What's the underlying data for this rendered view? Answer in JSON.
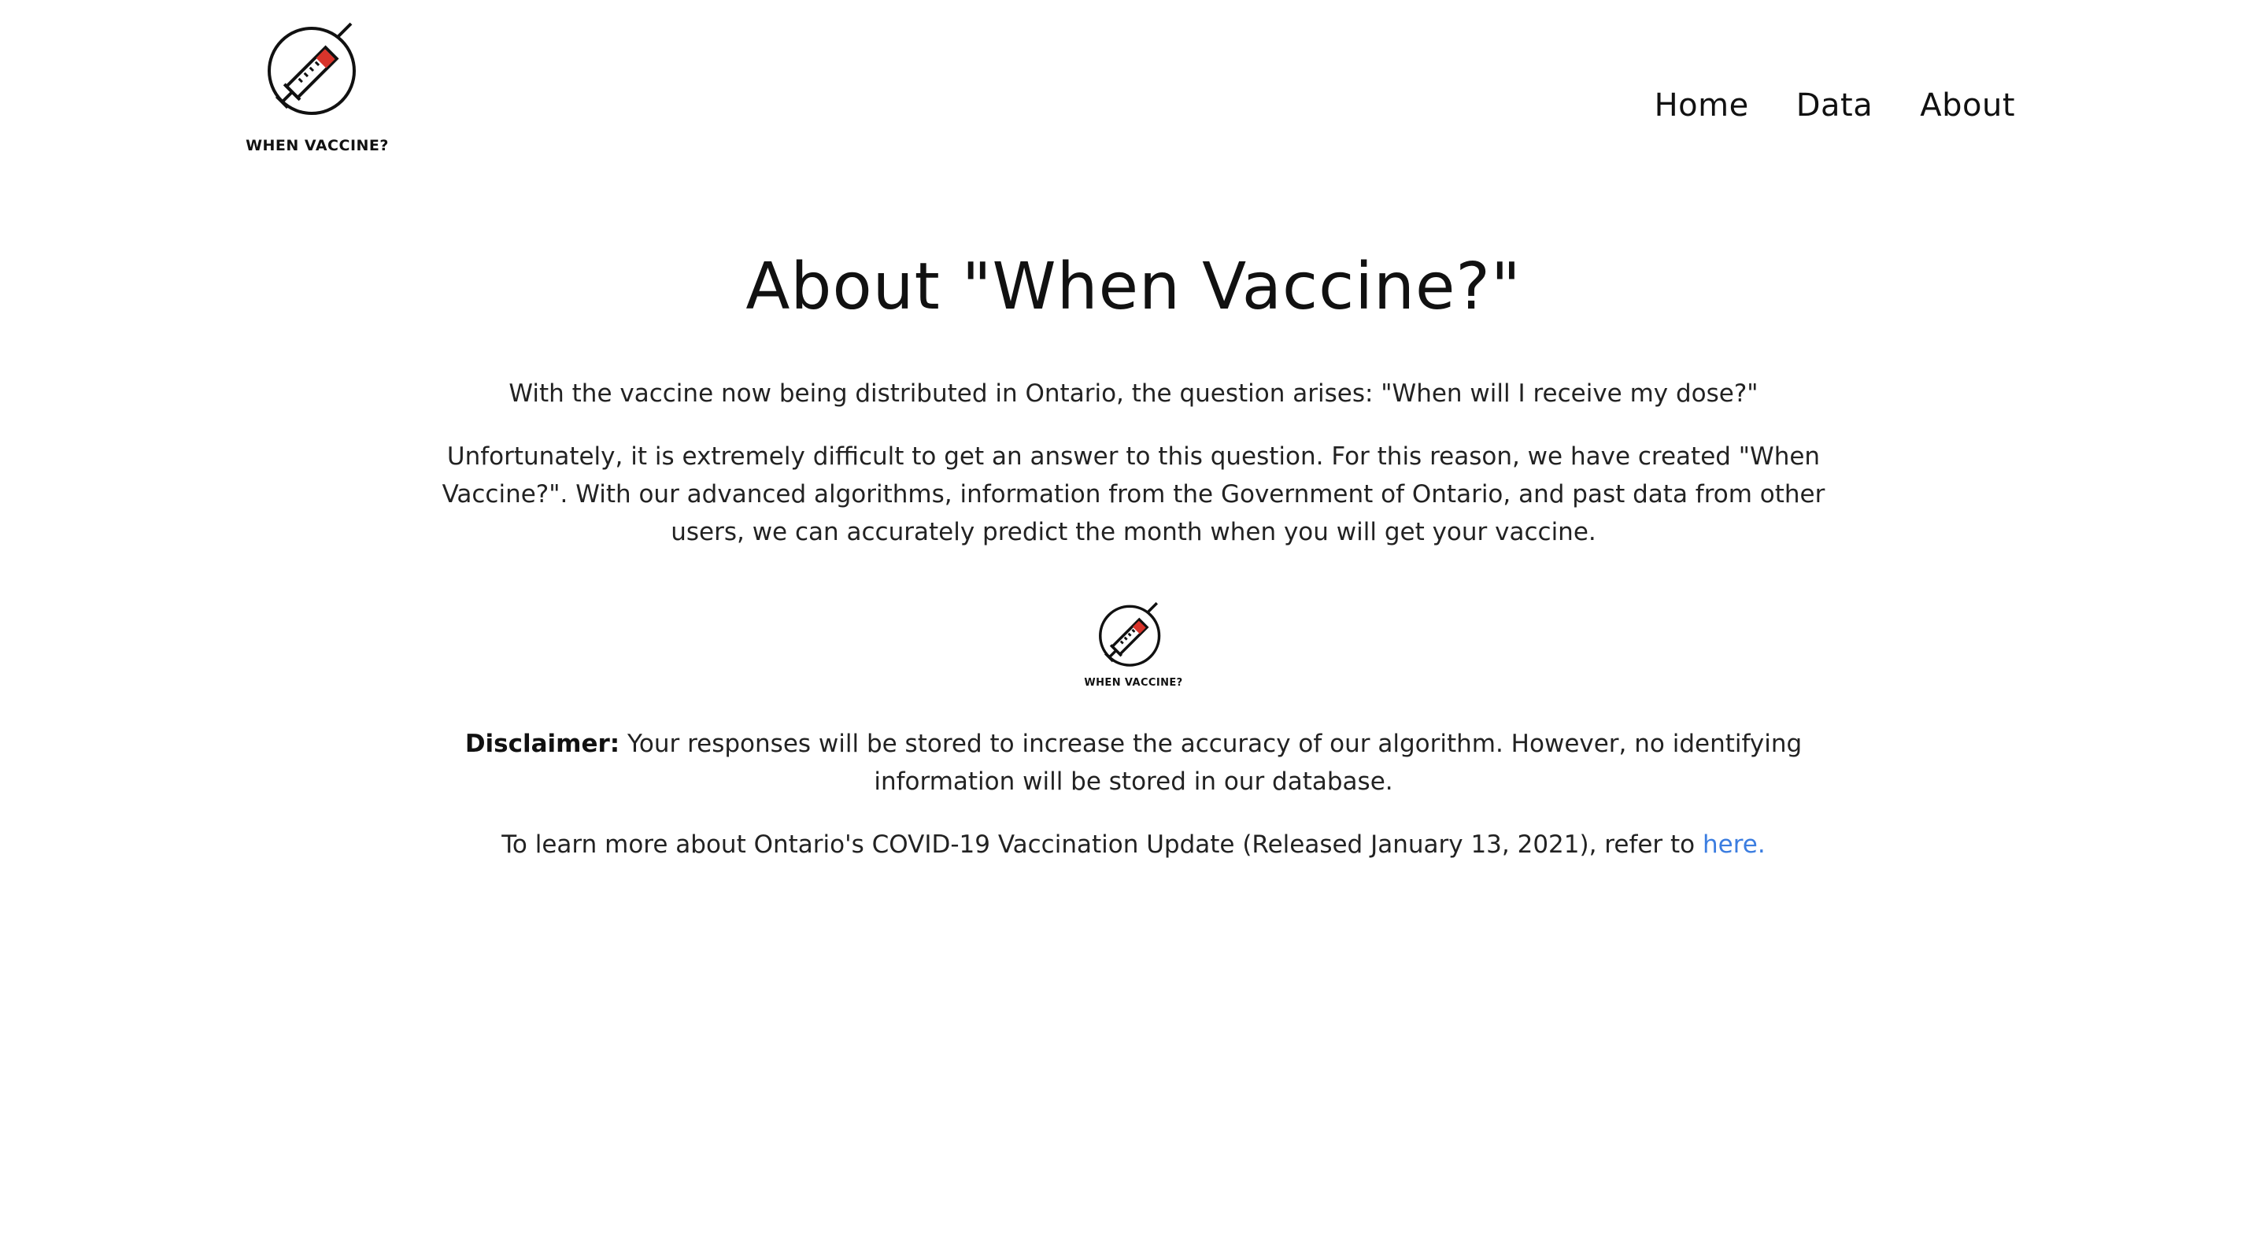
{
  "header": {
    "logo_text": "WHEN VACCINE?",
    "logo_icon": "syringe-circle-icon",
    "nav": [
      {
        "label": "Home"
      },
      {
        "label": "Data"
      },
      {
        "label": "About"
      }
    ]
  },
  "main": {
    "title": "About \"When Vaccine?\"",
    "intro": "With the vaccine now being distributed in Ontario, the question arises: \"When will I receive my dose?\"",
    "description": "Unfortunately, it is extremely difficult to get an answer to this question. For this reason, we have created \"When Vaccine?\". With our advanced algorithms, information from the Government of Ontario, and past data from other users, we can accurately predict the month when you will get your vaccine.",
    "mid_logo_text": "WHEN VACCINE?",
    "disclaimer_label": "Disclaimer:",
    "disclaimer_text": " Your responses will be stored to increase the accuracy of our algorithm. However, no identifying information will be stored in our database.",
    "learn_more_text": "To learn more about Ontario's COVID-19 Vaccination Update (Released January 13, 2021), refer to ",
    "learn_more_link": "here."
  },
  "colors": {
    "link": "#3b7de0",
    "accent_red": "#d9342b",
    "text": "#111111"
  }
}
